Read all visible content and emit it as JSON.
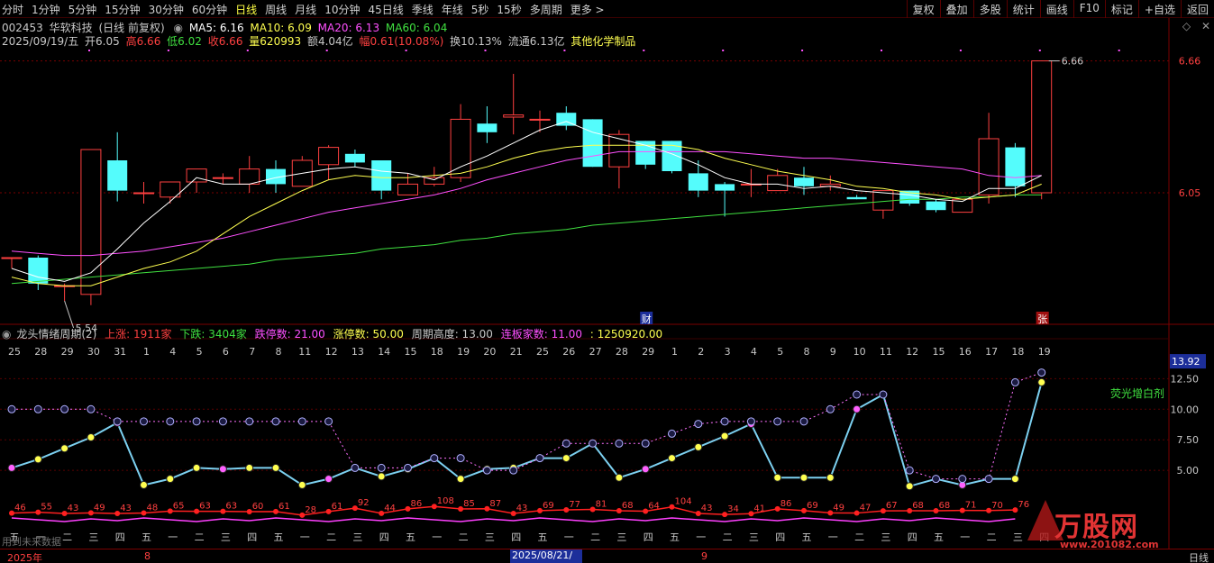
{
  "toolbar": {
    "periods": [
      "分时",
      "1分钟",
      "5分钟",
      "15分钟",
      "30分钟",
      "60分钟",
      "日线",
      "周线",
      "月线",
      "10分钟",
      "45日线",
      "季线",
      "年线",
      "5秒",
      "15秒",
      "多周期",
      "更多 >"
    ],
    "active_period": "日线",
    "right_buttons": [
      "复权",
      "叠加",
      "多股",
      "统计",
      "画线",
      "F10",
      "标记",
      "+自选",
      "返回"
    ]
  },
  "stock": {
    "code": "002453",
    "name": "华软科技",
    "mode": "(日线 前复权)",
    "ma5": "MA5: 6.16",
    "ma10": "MA10: 6.09",
    "ma20": "MA20: 6.13",
    "ma60": "MA60: 6.04"
  },
  "quote": {
    "date": "2025/09/19/五",
    "open": "开6.05",
    "high": "高6.66",
    "low": "低6.02",
    "close": "收6.66",
    "volume": "量620993",
    "amount": "额4.04亿",
    "change": "幅0.61(10.08%)",
    "turnover": "换10.13%",
    "float": "流通6.13亿",
    "industry": "其他化学制品"
  },
  "indicator": {
    "name": "龙头情绪周期(2)",
    "up": "上涨: 1911家",
    "down": "下跌: 3404家",
    "limit_down": "跌停数: 21.00",
    "limit_up": "涨停数: 50.00",
    "cycle_height": "周期高度: 13.00",
    "board_count": "连板家数: 11.00",
    "misc": ": 1250920.00",
    "fluorescent": "荧光增白剂",
    "no_data": "用到未来数据"
  },
  "axis": {
    "price_ticks": [
      "6.66",
      "6.05"
    ],
    "indicator_ticks": [
      "13.92",
      "12.50",
      "10.00",
      "7.50",
      "5.00"
    ],
    "day_labels": [
      "25",
      "28",
      "29",
      "30",
      "31",
      "1",
      "4",
      "5",
      "6",
      "7",
      "8",
      "11",
      "12",
      "13",
      "14",
      "15",
      "18",
      "19",
      "20",
      "21",
      "25",
      "26",
      "27",
      "28",
      "29",
      "1",
      "2",
      "3",
      "4",
      "5",
      "8",
      "9",
      "10",
      "11",
      "12",
      "15",
      "16",
      "17",
      "18",
      "19"
    ],
    "weekday_labels": [
      "五",
      "一",
      "二",
      "三",
      "四",
      "五",
      "一",
      "二",
      "三",
      "四",
      "五",
      "一",
      "二",
      "三",
      "四",
      "五",
      "一",
      "二",
      "三",
      "四",
      "五",
      "一",
      "二",
      "三",
      "四",
      "五",
      "一",
      "二",
      "三",
      "四",
      "五",
      "一",
      "二",
      "三",
      "四",
      "五",
      "一",
      "二",
      "三",
      "四"
    ],
    "max_label": "6.66",
    "min_label": "5.54",
    "event_cai": "财",
    "event_zhang": "张"
  },
  "bottom": {
    "year": "2025年",
    "month8": "8",
    "cursor_date": "2025/08/21/四",
    "month9": "9",
    "period": "日线"
  },
  "watermark": {
    "title": "万股网",
    "url": "www.201082.com"
  },
  "colors": {
    "up": "#ff4040",
    "down": "#54fcfc",
    "ma5": "#ffffff",
    "ma10": "#ffff50",
    "ma20": "#ff50ff",
    "ma60": "#40e040"
  },
  "chart_data": {
    "type": "candlestick",
    "dates": [
      "07/25",
      "07/28",
      "07/29",
      "07/30",
      "07/31",
      "08/01",
      "08/04",
      "08/05",
      "08/06",
      "08/07",
      "08/08",
      "08/11",
      "08/12",
      "08/13",
      "08/14",
      "08/15",
      "08/18",
      "08/19",
      "08/20",
      "08/21",
      "08/25",
      "08/26",
      "08/27",
      "08/28",
      "08/29",
      "09/01",
      "09/02",
      "09/03",
      "09/04",
      "09/05",
      "09/08",
      "09/09",
      "09/10",
      "09/11",
      "09/12",
      "09/15",
      "09/16",
      "09/17",
      "09/18",
      "09/19"
    ],
    "ohlc": [
      [
        5.75,
        5.75,
        5.7,
        5.75
      ],
      [
        5.75,
        5.76,
        5.6,
        5.63
      ],
      [
        5.62,
        5.63,
        5.55,
        5.62
      ],
      [
        5.58,
        6.25,
        5.53,
        6.25
      ],
      [
        6.2,
        6.33,
        6.01,
        6.06
      ],
      [
        6.05,
        6.1,
        6.0,
        6.05
      ],
      [
        6.03,
        6.1,
        6.0,
        6.1
      ],
      [
        6.1,
        6.16,
        6.05,
        6.16
      ],
      [
        6.12,
        6.14,
        6.09,
        6.12
      ],
      [
        6.09,
        6.22,
        6.05,
        6.16
      ],
      [
        6.16,
        6.2,
        6.05,
        6.09
      ],
      [
        6.08,
        6.22,
        6.08,
        6.2
      ],
      [
        6.18,
        6.27,
        6.11,
        6.26
      ],
      [
        6.23,
        6.25,
        6.17,
        6.19
      ],
      [
        6.2,
        6.2,
        6.02,
        6.06
      ],
      [
        6.04,
        6.14,
        6.04,
        6.09
      ],
      [
        6.09,
        6.17,
        6.08,
        6.12
      ],
      [
        6.12,
        6.46,
        6.1,
        6.39
      ],
      [
        6.37,
        6.45,
        6.28,
        6.33
      ],
      [
        6.4,
        6.6,
        6.32,
        6.41
      ],
      [
        6.39,
        6.43,
        6.33,
        6.39
      ],
      [
        6.42,
        6.45,
        6.34,
        6.36
      ],
      [
        6.39,
        6.39,
        6.17,
        6.17
      ],
      [
        6.17,
        6.34,
        6.07,
        6.32
      ],
      [
        6.29,
        6.29,
        6.16,
        6.18
      ],
      [
        6.29,
        6.29,
        6.14,
        6.15
      ],
      [
        6.14,
        6.2,
        6.03,
        6.06
      ],
      [
        6.09,
        6.1,
        5.94,
        6.06
      ],
      [
        6.09,
        6.16,
        6.03,
        6.09
      ],
      [
        6.06,
        6.16,
        6.06,
        6.13
      ],
      [
        6.12,
        6.17,
        6.04,
        6.08
      ],
      [
        6.08,
        6.13,
        6.06,
        6.09
      ],
      [
        6.03,
        6.04,
        6.02,
        6.02
      ],
      [
        5.97,
        6.03,
        5.93,
        6.06
      ],
      [
        6.06,
        6.06,
        5.99,
        6.0
      ],
      [
        6.01,
        6.02,
        5.96,
        5.97
      ],
      [
        5.96,
        6.01,
        5.96,
        6.02
      ],
      [
        6.04,
        6.42,
        6.0,
        6.3
      ],
      [
        6.26,
        6.28,
        6.03,
        6.08
      ],
      [
        6.05,
        6.66,
        6.02,
        6.66
      ]
    ],
    "ma5": [
      5.7,
      5.66,
      5.64,
      5.68,
      5.79,
      5.91,
      6.01,
      6.12,
      6.09,
      6.09,
      6.12,
      6.14,
      6.16,
      6.17,
      6.15,
      6.14,
      6.11,
      6.17,
      6.22,
      6.28,
      6.34,
      6.38,
      6.33,
      6.3,
      6.27,
      6.23,
      6.18,
      6.12,
      6.09,
      6.09,
      6.07,
      6.08,
      6.06,
      6.05,
      6.04,
      6.02,
      6.01,
      6.07,
      6.07,
      6.13
    ],
    "ma10": [
      5.66,
      5.63,
      5.62,
      5.62,
      5.66,
      5.7,
      5.73,
      5.78,
      5.86,
      5.94,
      6.0,
      6.06,
      6.11,
      6.13,
      6.12,
      6.12,
      6.13,
      6.14,
      6.17,
      6.21,
      6.24,
      6.26,
      6.27,
      6.27,
      6.27,
      6.27,
      6.25,
      6.21,
      6.18,
      6.15,
      6.13,
      6.11,
      6.08,
      6.07,
      6.05,
      6.04,
      6.02,
      6.03,
      6.04,
      6.09
    ],
    "ma20": [
      5.78,
      5.77,
      5.76,
      5.76,
      5.77,
      5.78,
      5.8,
      5.82,
      5.84,
      5.87,
      5.9,
      5.93,
      5.96,
      5.98,
      6.0,
      6.02,
      6.04,
      6.07,
      6.11,
      6.14,
      6.17,
      6.2,
      6.22,
      6.24,
      6.24,
      6.24,
      6.24,
      6.24,
      6.23,
      6.22,
      6.21,
      6.21,
      6.2,
      6.19,
      6.18,
      6.17,
      6.16,
      6.13,
      6.12,
      6.13
    ],
    "ma60": [
      5.63,
      5.64,
      5.65,
      5.66,
      5.67,
      5.68,
      5.69,
      5.7,
      5.71,
      5.72,
      5.74,
      5.75,
      5.76,
      5.77,
      5.79,
      5.8,
      5.81,
      5.83,
      5.84,
      5.86,
      5.87,
      5.88,
      5.9,
      5.91,
      5.92,
      5.93,
      5.94,
      5.95,
      5.96,
      5.97,
      5.98,
      5.99,
      6.0,
      6.01,
      6.02,
      6.02,
      6.03,
      6.03,
      6.04,
      6.04
    ],
    "price_ylim": [
      5.5,
      6.7
    ],
    "sentiment_line": [
      5.2,
      5.9,
      6.8,
      7.7,
      8.9,
      3.8,
      4.3,
      5.2,
      5.1,
      5.2,
      5.2,
      3.8,
      4.3,
      5.2,
      4.5,
      5.1,
      6.0,
      4.3,
      5.1,
      5.2,
      6.0,
      6.0,
      7.2,
      4.4,
      5.1,
      6.0,
      6.9,
      7.8,
      8.8,
      4.4,
      4.4,
      4.4,
      10.0,
      11.2,
      3.7,
      4.3,
      3.8,
      4.3,
      4.3,
      12.2,
      13.0
    ],
    "sentiment_ylim": [
      0,
      14
    ],
    "board_counts_red": [
      "46",
      "55",
      "43",
      "49",
      "43",
      "48",
      "65",
      "63",
      "63",
      "60",
      "61",
      "28",
      "61",
      "92",
      "44",
      "86",
      "108",
      "85",
      "87",
      "43",
      "69",
      "77",
      "81",
      "68",
      "64",
      "104",
      "43",
      "34",
      "41",
      "86",
      "69",
      "49",
      "47",
      "67",
      "68",
      "68",
      "71",
      "70",
      "76"
    ]
  }
}
